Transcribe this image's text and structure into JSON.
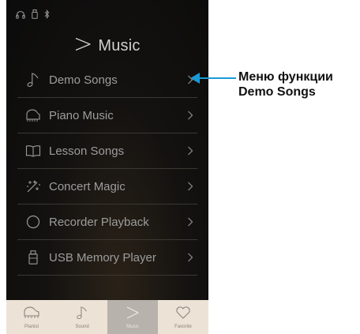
{
  "status_bar": {
    "icons": [
      "headphones-icon",
      "usb-icon",
      "bluetooth-icon"
    ]
  },
  "header": {
    "icon": "play-triangle-icon",
    "title": "Music"
  },
  "menu": {
    "items": [
      {
        "label": "Demo Songs",
        "icon": "music-note-icon"
      },
      {
        "label": "Piano Music",
        "icon": "grand-piano-icon"
      },
      {
        "label": "Lesson Songs",
        "icon": "open-book-icon"
      },
      {
        "label": "Concert Magic",
        "icon": "magic-sparkle-icon"
      },
      {
        "label": "Recorder Playback",
        "icon": "record-circle-icon"
      },
      {
        "label": "USB Memory Player",
        "icon": "usb-drive-icon"
      }
    ]
  },
  "bottom_nav": {
    "items": [
      {
        "label": "Pianist",
        "icon": "grand-piano-icon",
        "active": false
      },
      {
        "label": "Sound",
        "icon": "music-note-icon",
        "active": false
      },
      {
        "label": "Music",
        "icon": "play-triangle-icon",
        "active": true
      },
      {
        "label": "Favorite",
        "icon": "heart-icon",
        "active": false
      }
    ]
  },
  "callout": {
    "line1": "Меню функции",
    "line2": "Demo Songs",
    "color": "#1a9ad6"
  },
  "colors": {
    "screen_bg": "#0f0e0c",
    "menu_text": "#9d9d9d",
    "nav_bg": "#ece3d6",
    "nav_active_bg": "#b7b2ab"
  }
}
